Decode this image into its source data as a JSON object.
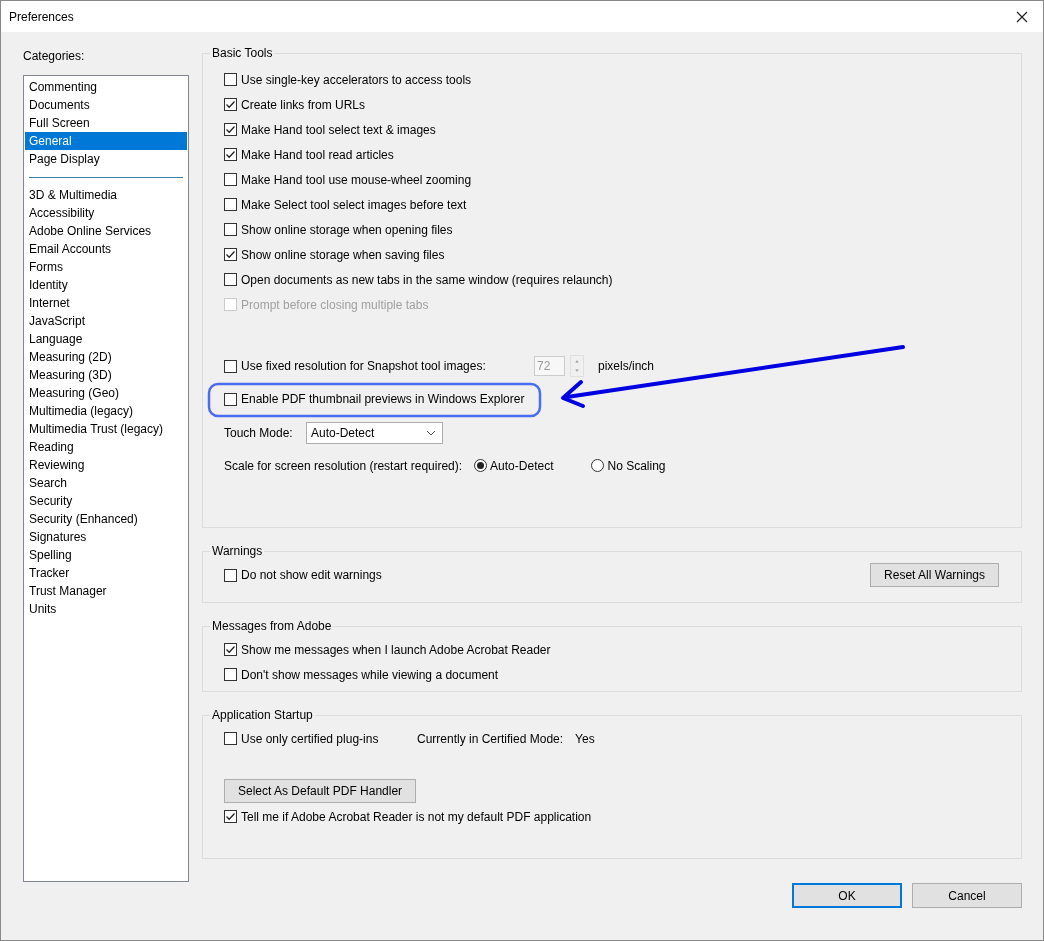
{
  "window": {
    "title": "Preferences"
  },
  "categories": {
    "label": "Categories:",
    "groups": [
      [
        {
          "label": "Commenting",
          "selected": false
        },
        {
          "label": "Documents",
          "selected": false
        },
        {
          "label": "Full Screen",
          "selected": false
        },
        {
          "label": "General",
          "selected": true
        },
        {
          "label": "Page Display",
          "selected": false
        }
      ],
      [
        {
          "label": "3D & Multimedia",
          "selected": false
        },
        {
          "label": "Accessibility",
          "selected": false
        },
        {
          "label": "Adobe Online Services",
          "selected": false
        },
        {
          "label": "Email Accounts",
          "selected": false
        },
        {
          "label": "Forms",
          "selected": false
        },
        {
          "label": "Identity",
          "selected": false
        },
        {
          "label": "Internet",
          "selected": false
        },
        {
          "label": "JavaScript",
          "selected": false
        },
        {
          "label": "Language",
          "selected": false
        },
        {
          "label": "Measuring (2D)",
          "selected": false
        },
        {
          "label": "Measuring (3D)",
          "selected": false
        },
        {
          "label": "Measuring (Geo)",
          "selected": false
        },
        {
          "label": "Multimedia (legacy)",
          "selected": false
        },
        {
          "label": "Multimedia Trust (legacy)",
          "selected": false
        },
        {
          "label": "Reading",
          "selected": false
        },
        {
          "label": "Reviewing",
          "selected": false
        },
        {
          "label": "Search",
          "selected": false
        },
        {
          "label": "Security",
          "selected": false
        },
        {
          "label": "Security (Enhanced)",
          "selected": false
        },
        {
          "label": "Signatures",
          "selected": false
        },
        {
          "label": "Spelling",
          "selected": false
        },
        {
          "label": "Tracker",
          "selected": false
        },
        {
          "label": "Trust Manager",
          "selected": false
        },
        {
          "label": "Units",
          "selected": false
        }
      ]
    ]
  },
  "basic_tools": {
    "title": "Basic Tools",
    "options": [
      {
        "label": "Use single-key accelerators to access tools",
        "checked": false,
        "disabled": false
      },
      {
        "label": "Create links from URLs",
        "checked": true,
        "disabled": false
      },
      {
        "label": "Make Hand tool select text & images",
        "checked": true,
        "disabled": false
      },
      {
        "label": "Make Hand tool read articles",
        "checked": true,
        "disabled": false
      },
      {
        "label": "Make Hand tool use mouse-wheel zooming",
        "checked": false,
        "disabled": false
      },
      {
        "label": "Make Select tool select images before text",
        "checked": false,
        "disabled": false
      },
      {
        "label": "Show online storage when opening files",
        "checked": false,
        "disabled": false
      },
      {
        "label": "Show online storage when saving files",
        "checked": true,
        "disabled": false
      },
      {
        "label": "Open documents as new tabs in the same window (requires relaunch)",
        "checked": false,
        "disabled": false
      },
      {
        "label": "Prompt before closing multiple tabs",
        "checked": false,
        "disabled": true
      }
    ],
    "snapshot": {
      "label": "Use fixed resolution for Snapshot tool images:",
      "checked": false,
      "value": "72",
      "unit": "pixels/inch"
    },
    "thumbnails": {
      "label": "Enable PDF thumbnail previews in Windows Explorer",
      "checked": false
    },
    "touch_mode": {
      "label": "Touch Mode:",
      "value": "Auto-Detect"
    },
    "scale": {
      "label": "Scale for screen resolution (restart required):",
      "options": [
        {
          "label": "Auto-Detect",
          "selected": true
        },
        {
          "label": "No Scaling",
          "selected": false
        }
      ]
    }
  },
  "warnings": {
    "title": "Warnings",
    "option": {
      "label": "Do not show edit warnings",
      "checked": false
    },
    "button": "Reset All Warnings"
  },
  "messages": {
    "title": "Messages from Adobe",
    "options": [
      {
        "label": "Show me messages when I launch Adobe Acrobat Reader",
        "checked": true
      },
      {
        "label": "Don't show messages while viewing a document",
        "checked": false
      }
    ]
  },
  "startup": {
    "title": "Application Startup",
    "certified": {
      "label": "Use only certified plug-ins",
      "checked": false
    },
    "mode_label": "Currently in Certified Mode:",
    "mode_value": "Yes",
    "button": "Select As Default PDF Handler",
    "default_check": {
      "label": "Tell me if Adobe Acrobat Reader is not my default PDF application",
      "checked": true
    }
  },
  "buttons": [
    {
      "label": "OK",
      "default": true
    },
    {
      "label": "Cancel",
      "default": false
    }
  ]
}
